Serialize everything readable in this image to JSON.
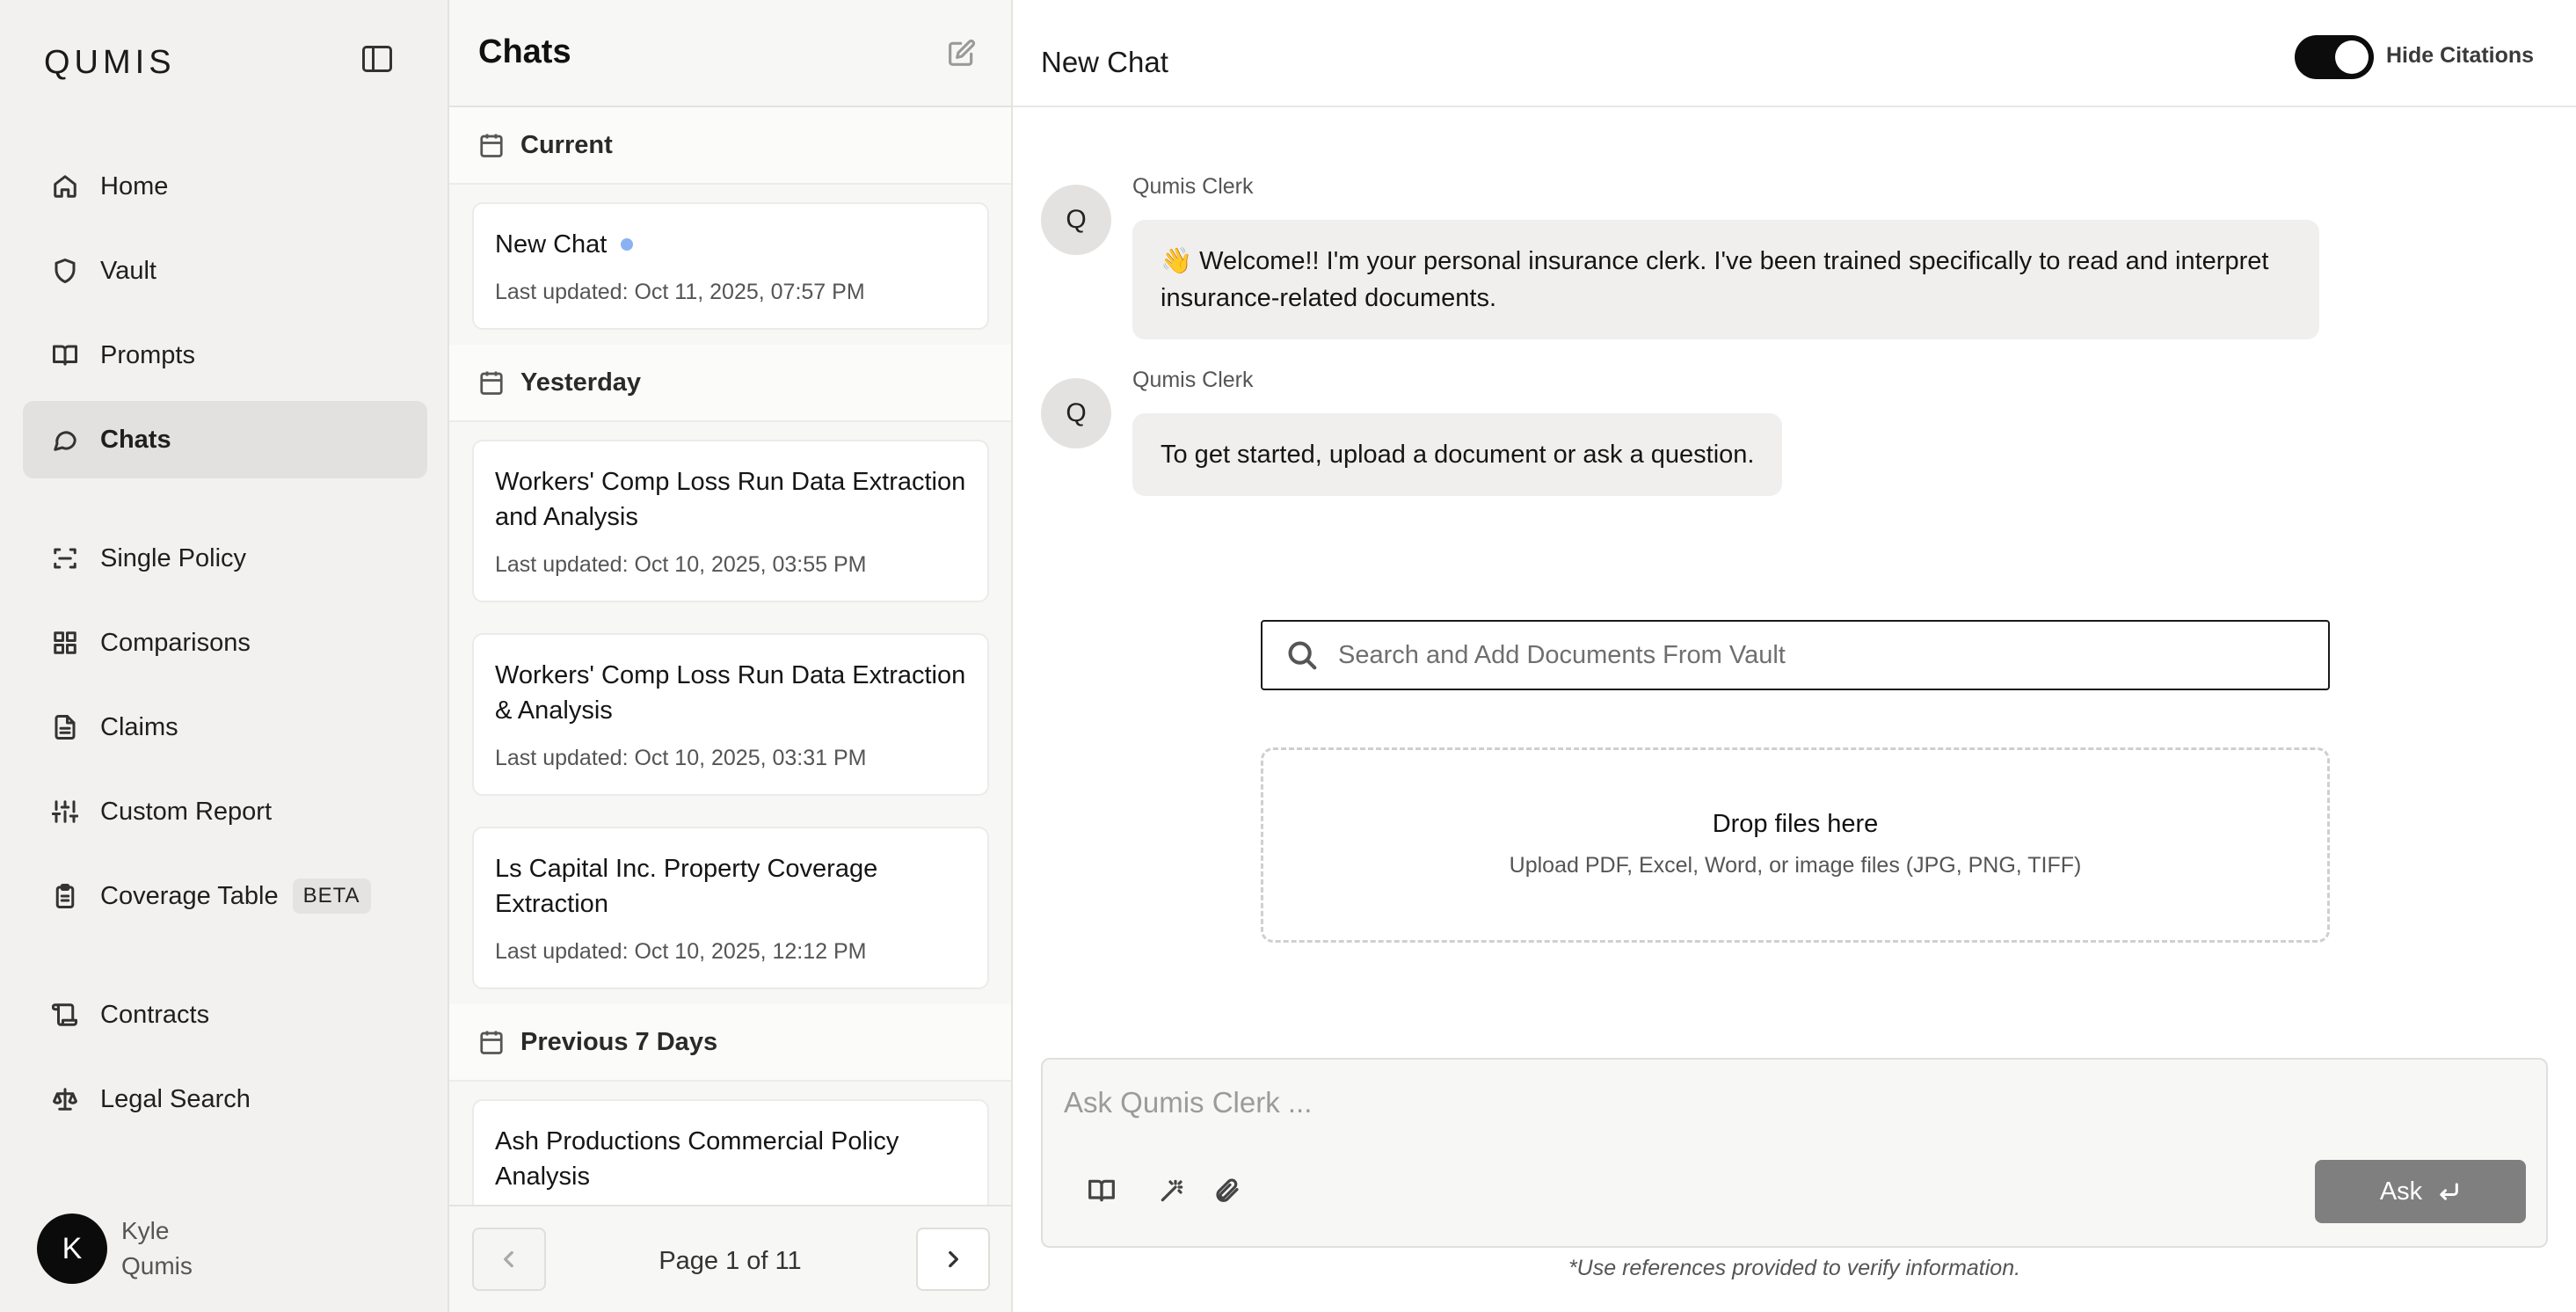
{
  "app": {
    "logo": "QUMIS"
  },
  "sidebar": {
    "items": [
      {
        "label": "Home",
        "icon": "home-icon"
      },
      {
        "label": "Vault",
        "icon": "shield-icon"
      },
      {
        "label": "Prompts",
        "icon": "book-icon"
      },
      {
        "label": "Chats",
        "icon": "chat-bubble-icon",
        "active": true
      },
      {
        "label": "Single Policy",
        "icon": "scan-icon"
      },
      {
        "label": "Comparisons",
        "icon": "grid-icon"
      },
      {
        "label": "Claims",
        "icon": "file-text-icon"
      },
      {
        "label": "Custom Report",
        "icon": "sliders-icon"
      },
      {
        "label": "Coverage Table",
        "icon": "clipboard-icon",
        "badge": "BETA"
      },
      {
        "label": "Contracts",
        "icon": "scroll-icon"
      },
      {
        "label": "Legal Search",
        "icon": "scale-icon"
      }
    ],
    "user": {
      "initial": "K",
      "first_name": "Kyle",
      "last_name": "Qumis"
    }
  },
  "chatlist": {
    "title": "Chats",
    "groups": [
      {
        "label": "Current"
      },
      {
        "label": "Yesterday"
      },
      {
        "label": "Previous 7 Days"
      }
    ],
    "chats": [
      {
        "title": "New Chat",
        "updated": "Last updated: Oct 11, 2025, 07:57 PM",
        "unread": true
      },
      {
        "title": "Workers' Comp Loss Run Data Extraction and Analysis",
        "updated": "Last updated: Oct 10, 2025, 03:55 PM"
      },
      {
        "title": "Workers' Comp Loss Run Data Extraction & Analysis",
        "updated": "Last updated: Oct 10, 2025, 03:31 PM"
      },
      {
        "title": "Ls Capital Inc. Property Coverage Extraction",
        "updated": "Last updated: Oct 10, 2025, 12:12 PM"
      },
      {
        "title": "Ash Productions Commercial Policy Analysis",
        "updated": ""
      }
    ],
    "pagination": "Page 1 of 11"
  },
  "main": {
    "title": "New Chat",
    "toggle_label": "Hide Citations",
    "toggle_on": true,
    "messages": [
      {
        "avatar": "Q",
        "sender": "Qumis Clerk",
        "text": "👋 Welcome!! I'm your personal insurance clerk. I've been trained specifically to read and interpret insurance-related documents."
      },
      {
        "avatar": "Q",
        "sender": "Qumis Clerk",
        "text": "To get started, upload a document or ask a question."
      }
    ],
    "search_placeholder": "Search and Add Documents From Vault",
    "dropzone": {
      "title": "Drop files here",
      "subtitle": "Upload PDF, Excel, Word, or image files (JPG, PNG, TIFF)"
    },
    "composer": {
      "placeholder": "Ask Qumis Clerk ...",
      "ask_label": "Ask"
    },
    "disclaimer": "*Use references provided to verify information."
  }
}
